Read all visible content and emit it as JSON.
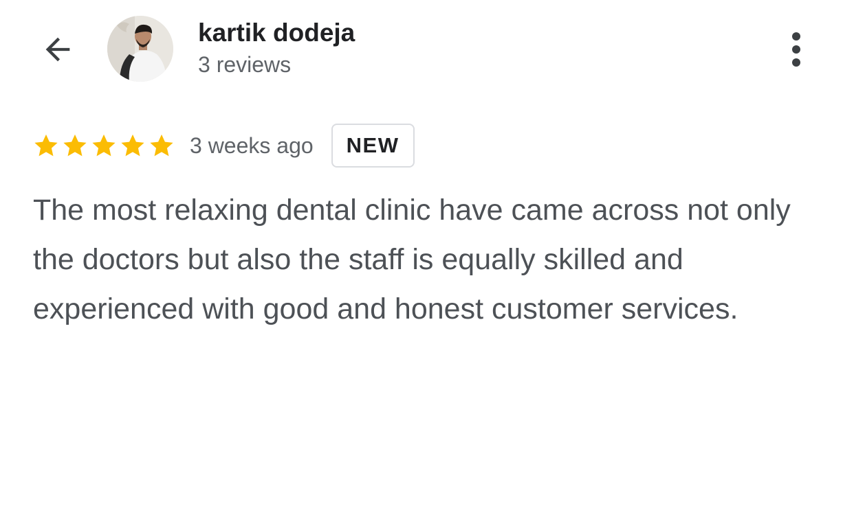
{
  "header": {
    "back_icon": "arrow-left-icon",
    "author_name": "kartik dodeja",
    "review_count": "3 reviews",
    "more_icon": "more-vert-icon"
  },
  "review": {
    "rating": 5,
    "rating_max": 5,
    "star_icon": "star-icon",
    "time_ago": "3 weeks ago",
    "badge": "NEW",
    "text": "The most relaxing dental clinic have came across not only the doctors but also the staff is equally skilled and experienced with good and honest customer services."
  },
  "colors": {
    "star": "#FBBC04",
    "primary_text": "#202124",
    "secondary_text": "#5F6368",
    "body_text": "#4D5156",
    "badge_border": "#DADCE0",
    "background": "#FFFFFF"
  }
}
